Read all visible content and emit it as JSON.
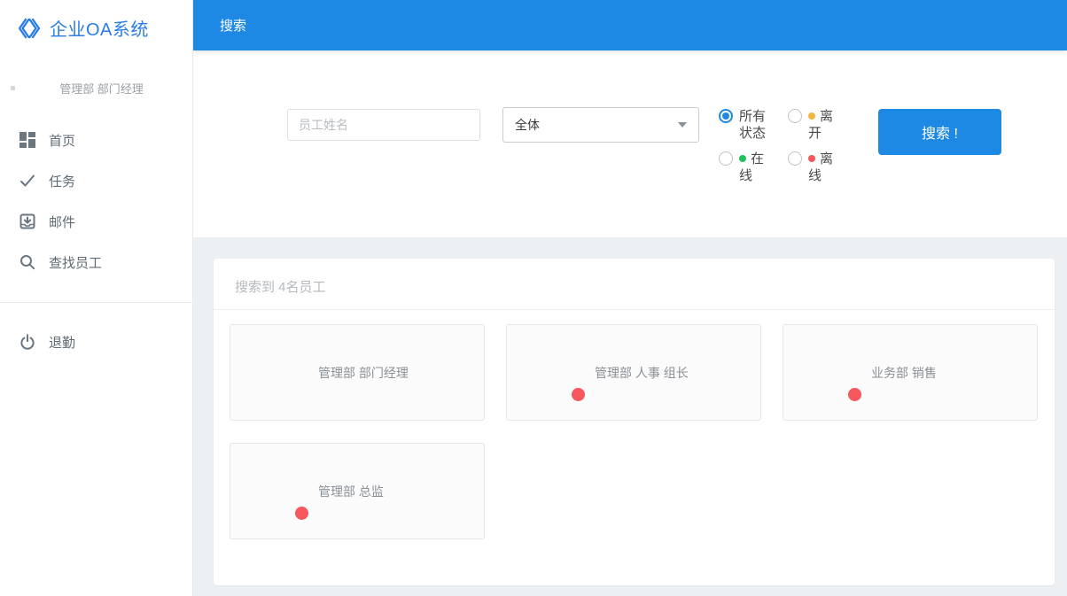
{
  "app": {
    "title": "企业OA系统"
  },
  "sidebar": {
    "user": {
      "label": "管理部 部门经理"
    },
    "items": [
      {
        "label": "首页",
        "icon": "dashboard-icon"
      },
      {
        "label": "任务",
        "icon": "check-icon"
      },
      {
        "label": "邮件",
        "icon": "mail-icon"
      },
      {
        "label": "查找员工",
        "icon": "search-icon"
      },
      {
        "label": "退勤",
        "icon": "power-icon"
      }
    ]
  },
  "header": {
    "title": "搜索"
  },
  "search_form": {
    "name_input": {
      "value": "",
      "placeholder": "员工姓名"
    },
    "department_select": {
      "value": "全体"
    },
    "status_options": [
      {
        "label": "所有状态",
        "selected": true,
        "dot_color": null
      },
      {
        "label": "离开",
        "selected": false,
        "dot_color": "#f0b73e"
      },
      {
        "label": "在线",
        "selected": false,
        "dot_color": "#21c25e"
      },
      {
        "label": "离线",
        "selected": false,
        "dot_color": "#f5575d"
      }
    ],
    "submit_label": "搜索 !"
  },
  "results": {
    "summary": "搜索到 4名员工",
    "employees": [
      {
        "label": "管理部 部门经理",
        "avatar": "none",
        "status_dot": null
      },
      {
        "label": "管理部 人事 组长",
        "avatar": "woman-portrait-photo",
        "status_dot": "#f5575d"
      },
      {
        "label": "业务部 销售",
        "avatar": "hotel-room-photo",
        "status_dot": "#f5575d"
      },
      {
        "label": "管理部 总监",
        "avatar": "living-room-photo",
        "status_dot": "#f5575d"
      }
    ]
  },
  "colors": {
    "accent": "#1e88e5",
    "online": "#21c25e",
    "away": "#f0b73e",
    "offline": "#f5575d"
  }
}
